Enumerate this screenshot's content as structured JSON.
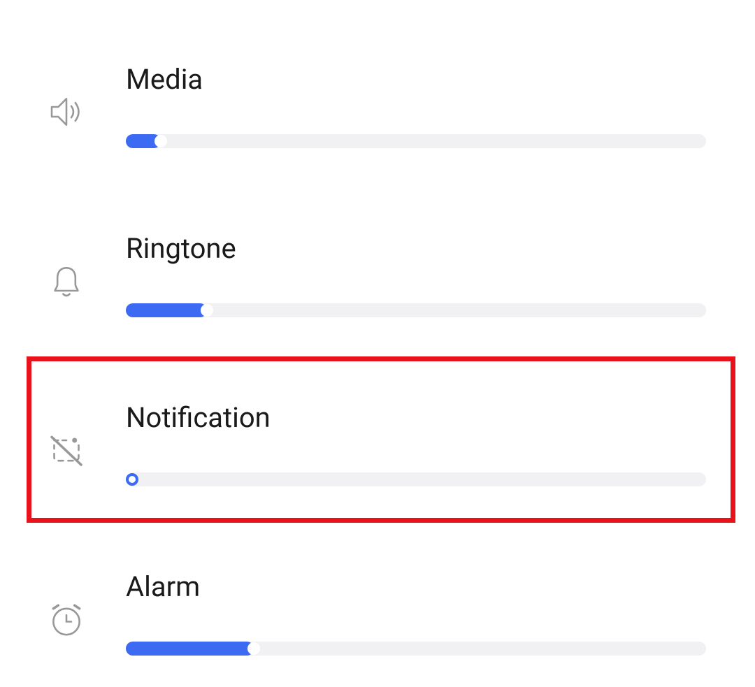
{
  "rows": [
    {
      "id": "media",
      "label": "Media",
      "value": 6,
      "icon": "speaker"
    },
    {
      "id": "ringtone",
      "label": "Ringtone",
      "value": 14,
      "icon": "bell"
    },
    {
      "id": "notification",
      "label": "Notification",
      "value": 0,
      "icon": "notification-off"
    },
    {
      "id": "alarm",
      "label": "Alarm",
      "value": 22,
      "icon": "alarm-clock"
    }
  ],
  "colors": {
    "accent": "#3d6af2",
    "track": "#f1f1f3",
    "icon": "#989898",
    "highlight": "#e8131a"
  }
}
